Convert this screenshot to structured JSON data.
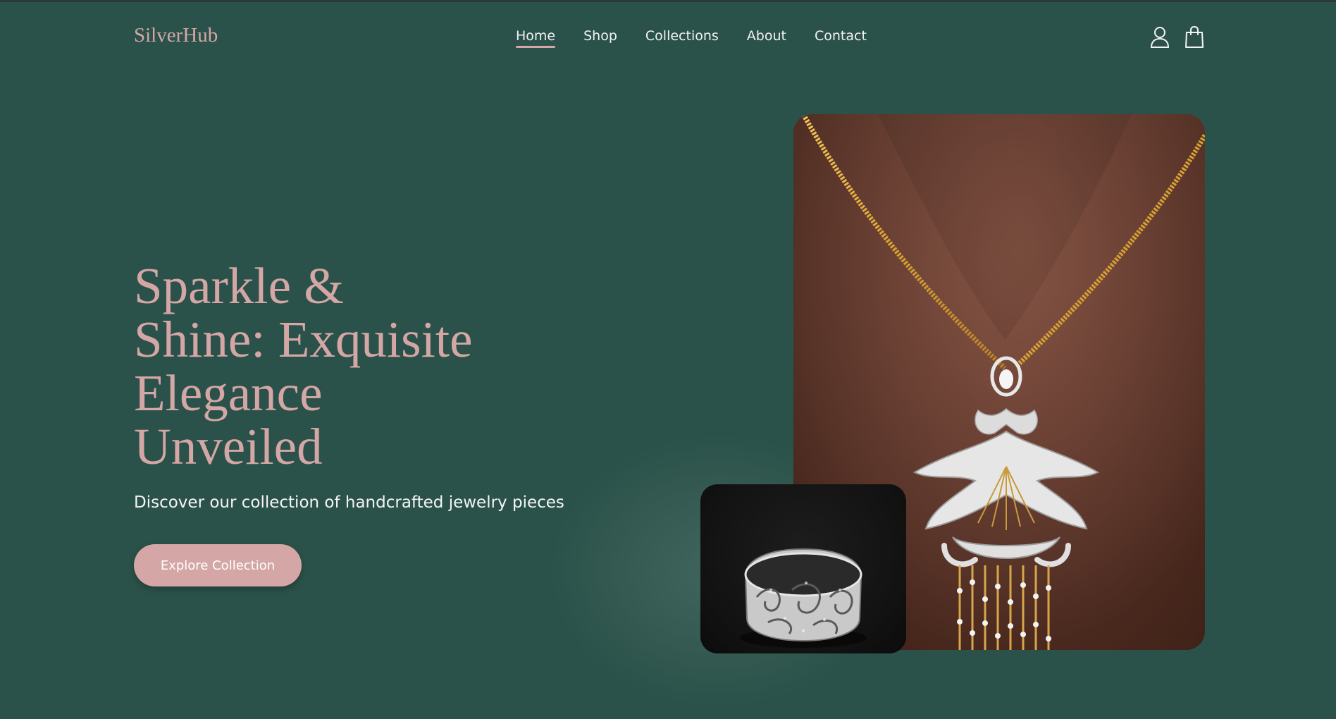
{
  "brand": {
    "logo_text": "SilverHub"
  },
  "nav": {
    "items": [
      {
        "label": "Home",
        "active": true
      },
      {
        "label": "Shop",
        "active": false
      },
      {
        "label": "Collections",
        "active": false
      },
      {
        "label": "About",
        "active": false
      },
      {
        "label": "Contact",
        "active": false
      }
    ],
    "icons": [
      "user-icon",
      "shopping-bag-icon"
    ]
  },
  "hero": {
    "title_lines": [
      "Sparkle &",
      "Shine: Exquisite",
      "Elegance",
      "Unveiled"
    ],
    "subtitle": "Discover our collection of handcrafted jewelry pieces",
    "cta_label": "Explore Collection"
  },
  "colors": {
    "background": "#2b524a",
    "accent": "#d4a7a6",
    "text": "#f2f2f2"
  }
}
